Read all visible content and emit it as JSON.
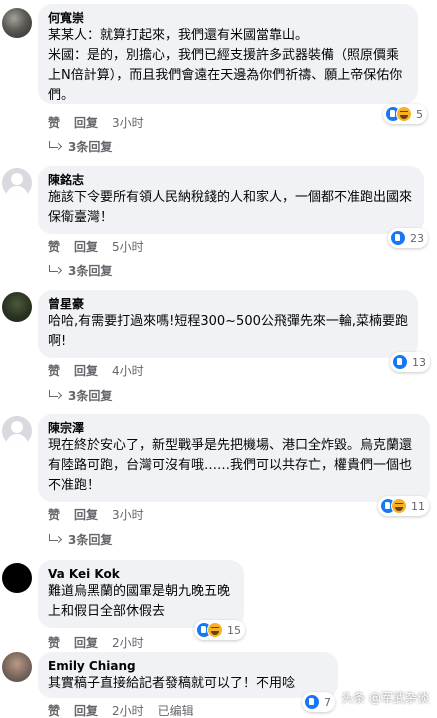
{
  "comments": [
    {
      "author": "何寬崇",
      "text": "某某人：就算打起來，我們還有米國當靠山。\n米國：是的，別擔心，我們已經支援許多武器裝備（照原價乘上N倍計算），而且我們會遠在天邊為你們祈禱、願上帝保佑你們。",
      "reaction_count": "5",
      "reactions": [
        "like-icon",
        "haha-icon"
      ],
      "like_label": "赞",
      "reply_label": "回复",
      "time": "3小时",
      "replies_label": "3条回复"
    },
    {
      "author": "陳銘志",
      "text": "施該下令要所有領人民納稅錢的人和家人，一個都不准跑出國來保衛臺灣！",
      "reaction_count": "23",
      "reactions": [
        "like-icon"
      ],
      "like_label": "赞",
      "reply_label": "回复",
      "time": "5小时",
      "replies_label": "3条回复"
    },
    {
      "author": "曾星豪",
      "text": "哈哈,有需要打過來嗎!短程300~500公飛彈先來一輪,菜楠要跑啊!",
      "reaction_count": "13",
      "reactions": [
        "like-icon"
      ],
      "like_label": "赞",
      "reply_label": "回复",
      "time": "4小时",
      "replies_label": "3条回复"
    },
    {
      "author": "陳宗澤",
      "text": "現在終於安心了，新型戰爭是先把機場、港口全炸毀。烏克蘭還有陸路可跑，台灣可沒有哦……我們可以共存亡，權貴們一個也不准跑！",
      "reaction_count": "11",
      "reactions": [
        "like-icon",
        "haha-icon"
      ],
      "like_label": "赞",
      "reply_label": "回复",
      "time": "3小时",
      "replies_label": "3条回复"
    },
    {
      "author": "Va Kei Kok",
      "text": "難道烏黑蘭的國軍是朝九晚五晚上和假日全部休假去",
      "reaction_count": "15",
      "reactions": [
        "like-icon",
        "haha-icon"
      ],
      "like_label": "赞",
      "reply_label": "回复",
      "time": "2小时"
    },
    {
      "author": "Emily Chiang",
      "text": "其實稿子直接給記者發稿就可以了！不用唸",
      "reaction_count": "7",
      "reactions": [
        "like-icon"
      ],
      "like_label": "赞",
      "reply_label": "回复",
      "time": "2小时",
      "edited_label": "已编辑"
    }
  ],
  "watermark": "头条 @军武杂谈",
  "colors": {
    "bubble": "#f0f2f5",
    "meta": "#65676b",
    "like": "#1877f2",
    "haha": "#f7b125"
  }
}
